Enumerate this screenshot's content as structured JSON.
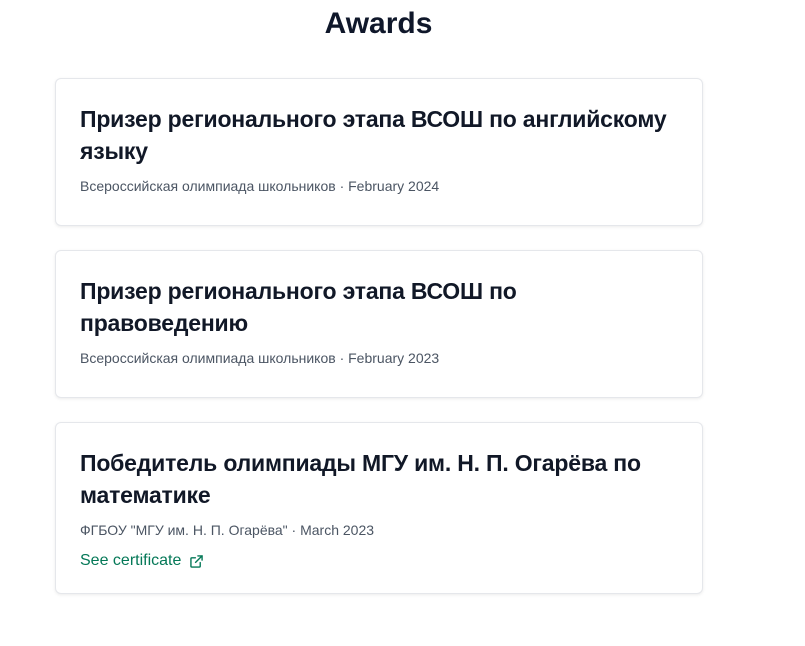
{
  "page": {
    "title": "Awards"
  },
  "awards": [
    {
      "title": "Призер регионального этапа ВСОШ по английскому языку",
      "issuer": "Всероссийская олимпиада школьников",
      "separator": "·",
      "date": "February 2024"
    },
    {
      "title": "Призер регионального этапа ВСОШ по правоведению",
      "issuer": "Всероссийская олимпиада школьников",
      "separator": "·",
      "date": "February 2023"
    },
    {
      "title": "Победитель олимпиады МГУ им. Н. П. Огарёва по математике",
      "issuer": "ФГБОУ \"МГУ им. Н. П. Огарёва\"",
      "separator": "·",
      "date": "March 2023",
      "link_label": "See certificate",
      "link_icon": "external-link-icon"
    }
  ],
  "colors": {
    "link": "#047857",
    "title": "#111827",
    "meta": "#4b5563",
    "card_border": "#e5e7eb"
  }
}
